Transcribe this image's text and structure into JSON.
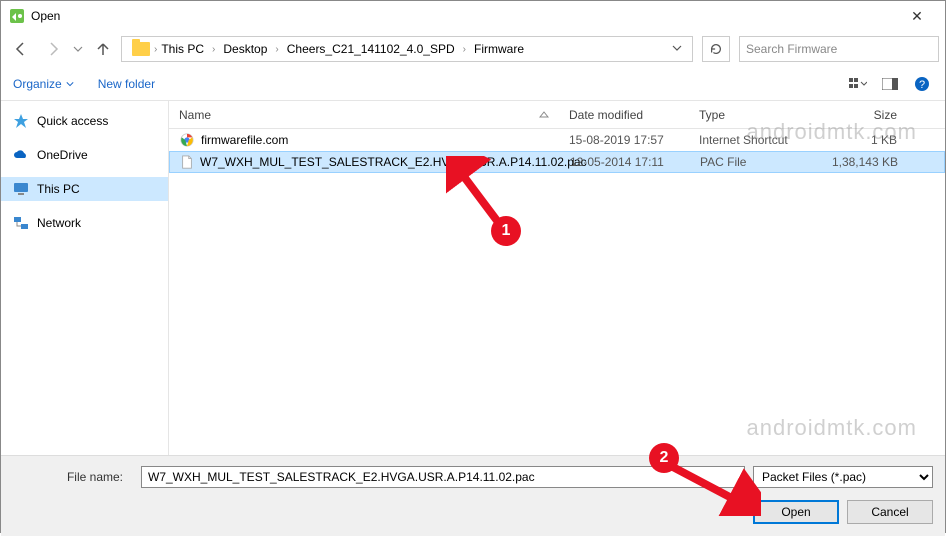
{
  "window": {
    "title": "Open"
  },
  "breadcrumbs": {
    "root": "This PC",
    "c1": "Desktop",
    "c2": "Cheers_C21_141102_4.0_SPD",
    "c3": "Firmware"
  },
  "search": {
    "placeholder": "Search Firmware"
  },
  "toolbar": {
    "organize": "Organize",
    "newfolder": "New folder"
  },
  "columns": {
    "name": "Name",
    "date": "Date modified",
    "type": "Type",
    "size": "Size"
  },
  "nav": {
    "quick": "Quick access",
    "onedrive": "OneDrive",
    "thispc": "This PC",
    "network": "Network"
  },
  "files": [
    {
      "name": "firmwarefile.com",
      "date": "15-08-2019 17:57",
      "type": "Internet Shortcut",
      "size": "1 KB",
      "icon": "chrome"
    },
    {
      "name": "W7_WXH_MUL_TEST_SALESTRACK_E2.HVGA.USR.A.P14.11.02.pac",
      "date": "12-05-2014 17:11",
      "type": "PAC File",
      "size": "1,38,143 KB",
      "icon": "file"
    }
  ],
  "footer": {
    "label": "File name:",
    "value": "W7_WXH_MUL_TEST_SALESTRACK_E2.HVGA.USR.A.P14.11.02.pac",
    "filter": "Packet Files (*.pac)",
    "open": "Open",
    "cancel": "Cancel"
  },
  "watermark": "androidmtk.com",
  "callouts": {
    "one": "1",
    "two": "2"
  }
}
